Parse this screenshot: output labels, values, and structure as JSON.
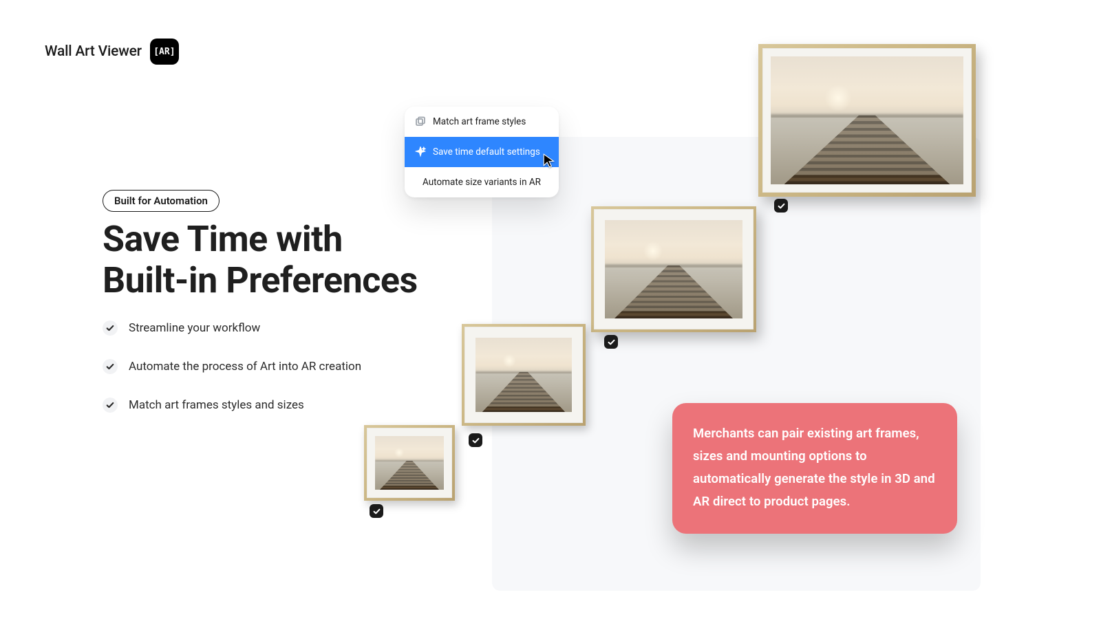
{
  "brand": {
    "name": "Wall Art Viewer",
    "badge": "[AR]"
  },
  "tag": "Built for Automation",
  "headline_line1": "Save Time with",
  "headline_line2": "Built-in Preferences",
  "bullets": [
    "Streamline your workflow",
    "Automate the process of Art into AR creation",
    "Match art frames styles and sizes"
  ],
  "menu": {
    "item1": "Match art frame styles",
    "item2": "Save time default settings",
    "item3": "Automate size variants in AR"
  },
  "callout": "Merchants can pair existing art frames, sizes and mounting options to automatically generate the style in 3D and AR direct to product pages."
}
